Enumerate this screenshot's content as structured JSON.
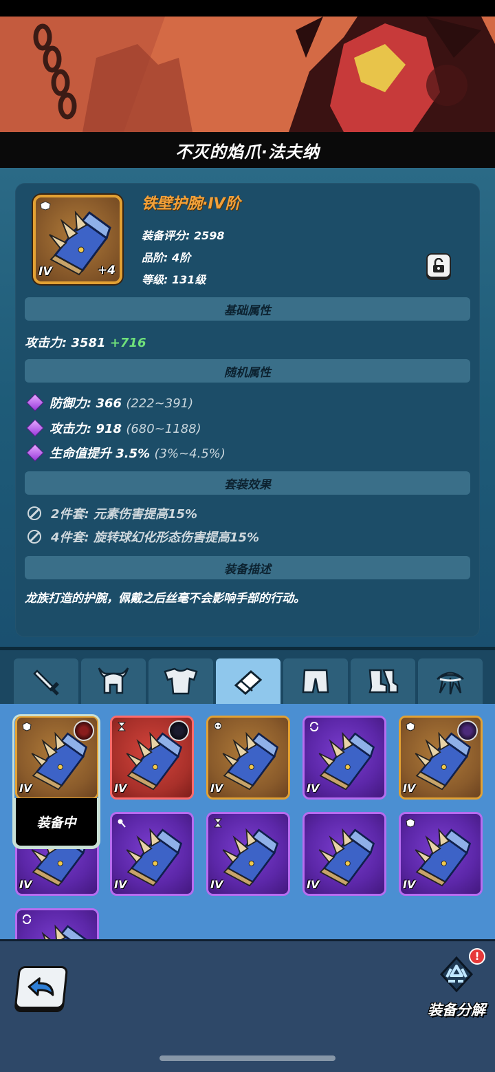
{
  "hero": {
    "title": "不灭的焰爪·法夫纳"
  },
  "item": {
    "name": "铁壁护腕·IV阶",
    "score_label": "装备评分: 2598",
    "quality_label": "品阶: 4阶",
    "level_label": "等级: 131级",
    "tier": "IV",
    "enhance": "+4"
  },
  "sections": {
    "base": "基础属性",
    "random": "随机属性",
    "set": "套装效果",
    "desc": "装备描述"
  },
  "base_attr": {
    "label": "攻击力: 3581",
    "bonus": "+716"
  },
  "random_attrs": [
    {
      "label": "防御力: 366",
      "range": "(222~391)"
    },
    {
      "label": "攻击力: 918",
      "range": "(680~1188)"
    },
    {
      "label": "生命值提升 3.5%",
      "range": "(3%~4.5%)"
    }
  ],
  "set_effects": [
    {
      "label": "2件套: 元素伤害提高15%"
    },
    {
      "label": "4件套: 旋转球幻化形态伤害提高15%"
    }
  ],
  "description": "龙族打造的护腕，佩戴之后丝毫不会影响手部的行动。",
  "tabs": [
    {
      "name": "weapon",
      "icon": "sword-icon"
    },
    {
      "name": "helmet",
      "icon": "horned-helmet-icon"
    },
    {
      "name": "armor",
      "icon": "armor-icon"
    },
    {
      "name": "bracer",
      "icon": "bracer-icon",
      "active": true
    },
    {
      "name": "pants",
      "icon": "pants-icon"
    },
    {
      "name": "boots",
      "icon": "boots-icon"
    },
    {
      "name": "accessory",
      "icon": "claw-icon"
    }
  ],
  "inventory": {
    "equipped_label": "装备中",
    "tier_label": "IV",
    "cards": [
      {
        "rarity": "orange",
        "mark": "shield",
        "avatar": "red"
      },
      {
        "rarity": "red",
        "mark": "hourglass",
        "avatar": "dark"
      },
      {
        "rarity": "orange",
        "mark": "skull"
      },
      {
        "rarity": "purple",
        "mark": "cycle"
      },
      {
        "rarity": "orange",
        "mark": "shield",
        "avatar": "purple"
      },
      {
        "rarity": "purple",
        "mark": ""
      },
      {
        "rarity": "purple",
        "mark": "wand"
      },
      {
        "rarity": "purple",
        "mark": "hourglass"
      },
      {
        "rarity": "purple",
        "mark": ""
      },
      {
        "rarity": "purple",
        "mark": "shield"
      },
      {
        "rarity": "purple",
        "mark": "cycle"
      }
    ]
  },
  "bottom": {
    "salvage_label": "装备分解",
    "alert": "!"
  },
  "colors": {
    "accent_orange": "#f2a13a",
    "bonus_green": "#6fe07a",
    "panel": "#1c4d68",
    "section_header": "#3a6f89"
  }
}
